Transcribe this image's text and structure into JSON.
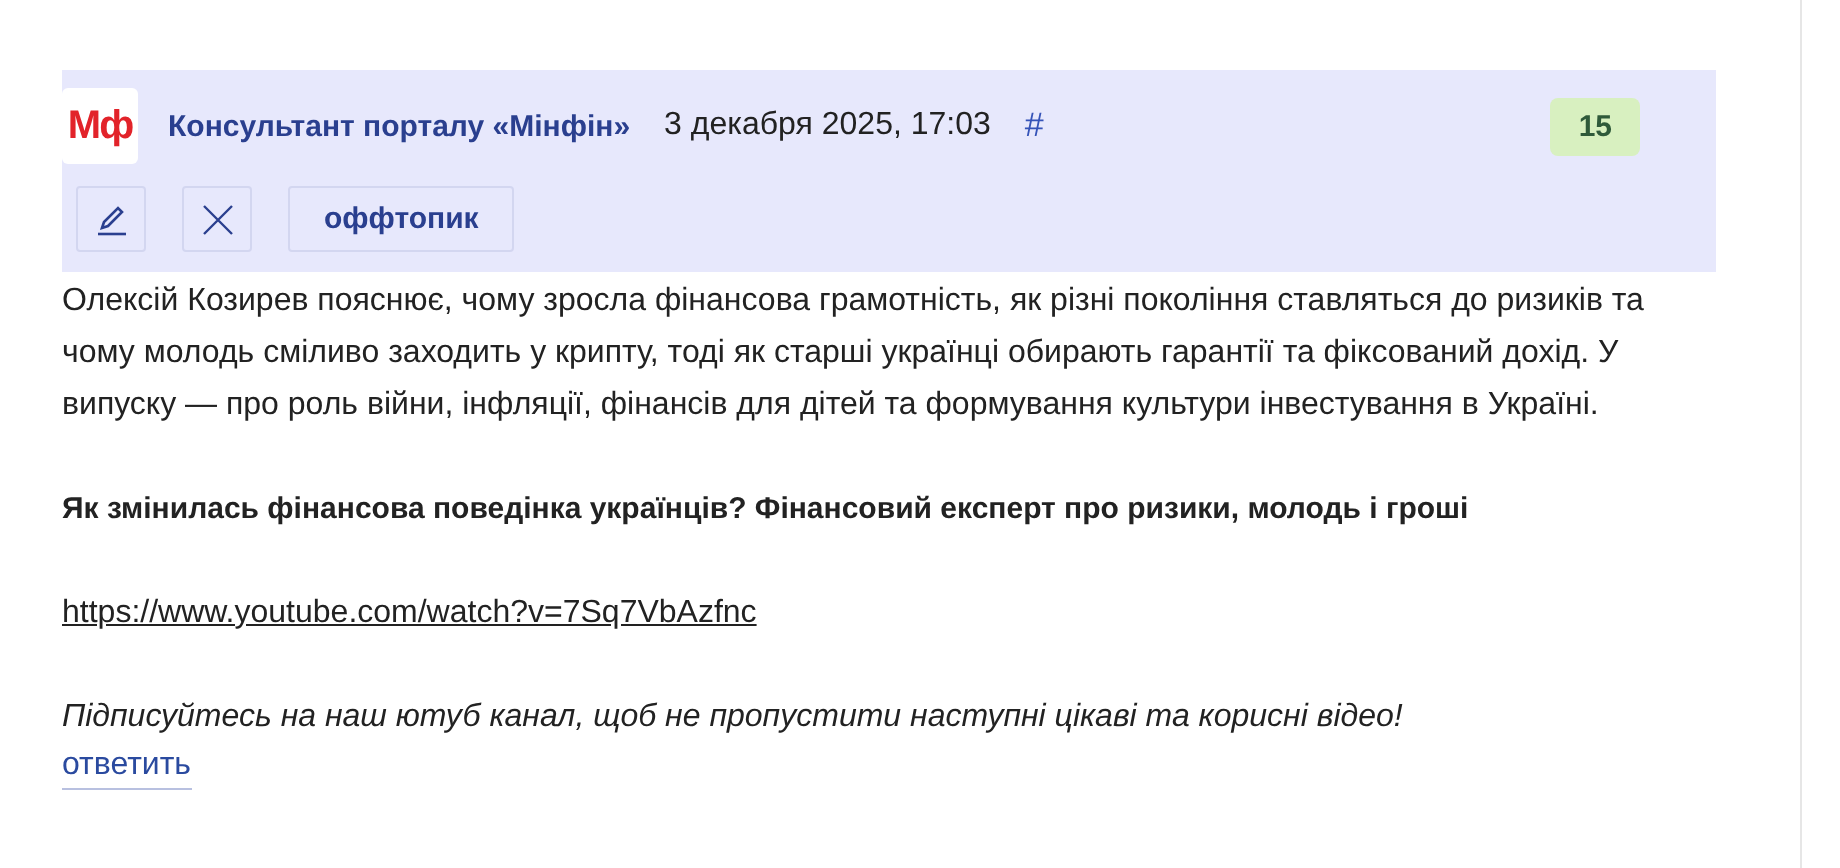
{
  "comment": {
    "avatar": "Мф",
    "author": "Консультант порталу «Мінфін»",
    "date": "3 декабря 2025, 17:03",
    "anchor": "#",
    "rating": "15",
    "actions": [
      {
        "kind": "edit"
      },
      {
        "kind": "delete"
      },
      {
        "kind": "tag",
        "label": "оффтопик"
      }
    ],
    "body": [
      {
        "kind": "text",
        "text": "Олексій Козирев пояснює, чому зросла фінансова грамотність, як різні покоління ставляться до ризиків та чому молодь сміливо заходить у крипту, тоді як старші українці обирають гарантії та фіксований дохід. У випуску — про роль війни, інфляції, фінансів для дітей та формування культури інвестування в Україні."
      },
      {
        "kind": "bold",
        "text": "Як змінилась фінансова поведінка українців? Фінансовий експерт про ризики, молодь і гроші"
      },
      {
        "kind": "link",
        "text": "https://www.youtube.com/watch?v=7Sq7VbAzfnc"
      },
      {
        "kind": "italic",
        "text": "Підписуйтесь на наш ютуб канал, щоб не пропустити наступні цікаві та корисні відео!"
      }
    ],
    "reply": "ответить"
  }
}
